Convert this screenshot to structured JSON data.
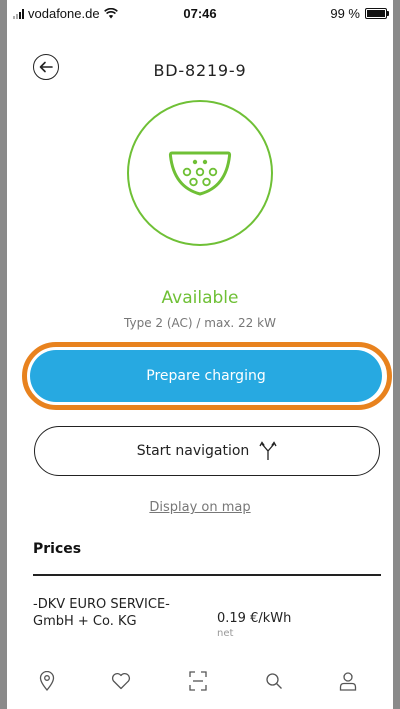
{
  "status_bar": {
    "carrier": "vodafone.de",
    "time": "07:46",
    "battery": "99 %"
  },
  "header": {
    "title": "BD-8219-9"
  },
  "connector": {
    "status": "Available",
    "info": "Type 2 (AC) / max. 22 kW"
  },
  "actions": {
    "prepare_label": "Prepare charging",
    "navigation_label": "Start navigation",
    "map_link": "Display on map"
  },
  "prices": {
    "title": "Prices",
    "items": [
      {
        "provider": "-DKV EURO SERVICE- GmbH + Co. KG",
        "price": "0.19 €/kWh",
        "note": "net"
      }
    ]
  },
  "tabbar": {
    "items": [
      "location-pin-icon",
      "heart-icon",
      "scan-icon",
      "search-icon",
      "profile-icon"
    ]
  },
  "colors": {
    "accent_green": "#6fc036",
    "primary_blue": "#27a9e1",
    "highlight_orange": "#e8821e"
  }
}
